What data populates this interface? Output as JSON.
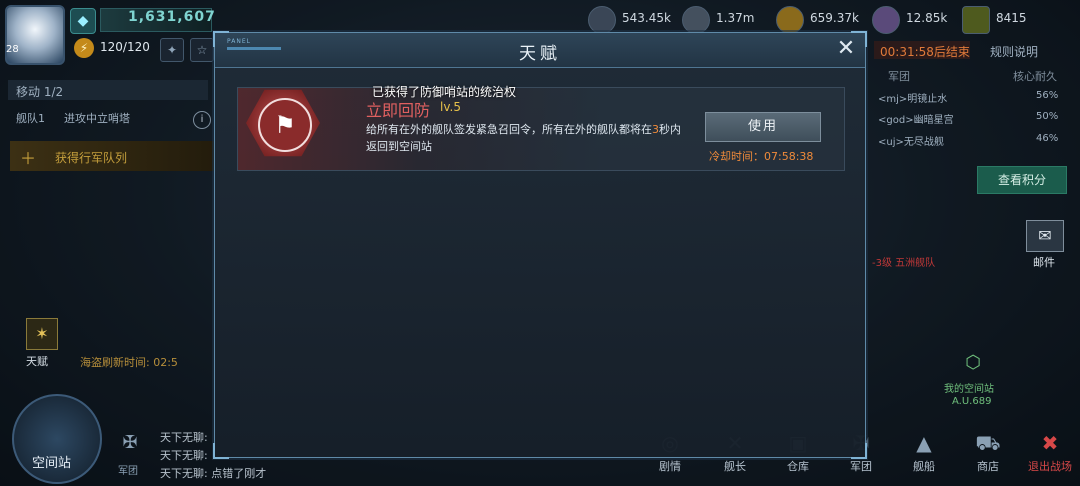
{
  "player": {
    "level": "28",
    "power": "1,631,607",
    "energy": "120/120"
  },
  "resources": [
    {
      "icon": "fuel-icon",
      "value": "543.45k"
    },
    {
      "icon": "metal-icon",
      "value": "1.37m"
    },
    {
      "icon": "gas-icon",
      "value": "659.37k"
    },
    {
      "icon": "crystal-icon",
      "value": "12.85k"
    },
    {
      "icon": "credit-icon",
      "value": "8415"
    }
  ],
  "left_panel": {
    "move_label": "移动 1/2",
    "fleet_name": "舰队1",
    "fleet_task": "进攻中立哨塔",
    "gain_label": "获得行军队列",
    "talent_label": "天赋",
    "pirate_refresh": "海盗刷新时间: 02:5",
    "station_label": "空间站",
    "legion_label": "军团"
  },
  "chat": [
    "天下无聊: ",
    "天下无聊: ",
    "天下无聊: 点错了刚才"
  ],
  "right_panel": {
    "timer": "00:31:58后结束",
    "rules": "规则说明",
    "col_legion": "军团",
    "col_hp": "核心耐久",
    "ranks": [
      {
        "name": "<mj>明镜止水",
        "hp": "56%"
      },
      {
        "name": "<god>幽暗星宫",
        "hp": "50%"
      },
      {
        "name": "<uj>无尽战舰",
        "hp": "46%"
      }
    ],
    "score_button": "查看积分",
    "mail_label": "邮件",
    "red_mark": "-3级 五洲舰队",
    "my_station": "我的空间站",
    "my_station_coord": "A.U.689"
  },
  "nav": [
    {
      "icon": "story-icon",
      "label": "剧情"
    },
    {
      "icon": "captain-icon",
      "label": "舰长"
    },
    {
      "icon": "warehouse-icon",
      "label": "仓库"
    },
    {
      "icon": "legion-nav-icon",
      "label": "军团"
    },
    {
      "icon": "ship-icon",
      "label": "舰船"
    },
    {
      "icon": "shop-icon",
      "label": "商店"
    },
    {
      "icon": "exit-icon",
      "label": "退出战场"
    }
  ],
  "modal": {
    "panel_tag": "PANEL",
    "title": "天赋",
    "talent": {
      "banner": "已获得了防御哨站的统治权",
      "name": "立即回防",
      "level": "lv.5",
      "desc_before": "给所有在外的舰队签发紧急召回令，所有在外的舰队都将在",
      "desc_highlight": "3",
      "desc_after": "秒内返回到空间站",
      "use_button": "使用",
      "cooldown": "冷却时间：07:58:38"
    }
  }
}
